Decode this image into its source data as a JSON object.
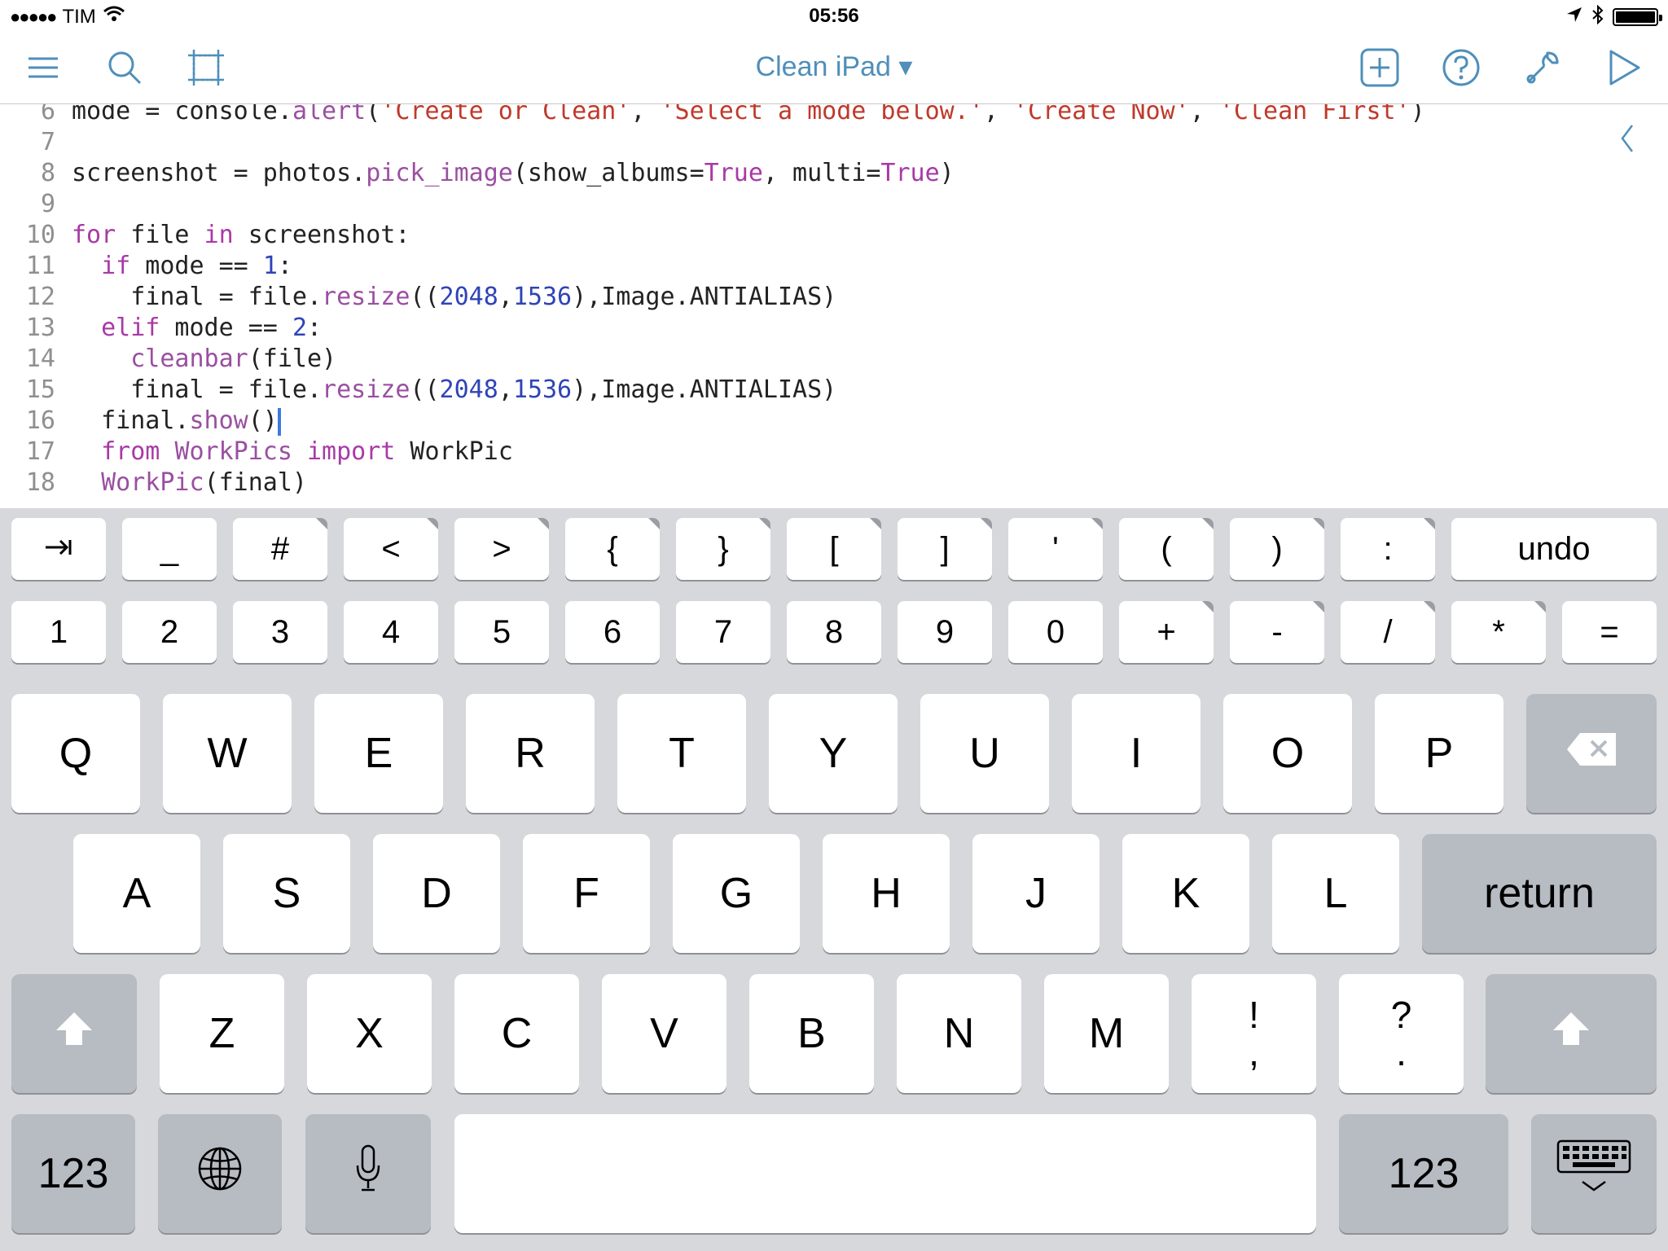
{
  "status_bar": {
    "signal": "●●●●●",
    "carrier": "TIM",
    "time": "05:56",
    "battery_level": 1.0
  },
  "toolbar": {
    "title": "Clean iPad ▾",
    "icons": [
      "menu-icon",
      "search-icon",
      "grid-icon",
      "add-icon",
      "help-icon",
      "wrench-icon",
      "play-icon"
    ],
    "accent_color": "#4f8fba"
  },
  "editor": {
    "lines": [
      {
        "n": "6",
        "code": [
          {
            "t": "mode = console.",
            "c": "plain"
          },
          {
            "t": "alert",
            "c": "fn"
          },
          {
            "t": "(",
            "c": "plain"
          },
          {
            "t": "'Create or Clean'",
            "c": "str"
          },
          {
            "t": ", ",
            "c": "plain"
          },
          {
            "t": "'Select a mode below.'",
            "c": "str"
          },
          {
            "t": ", ",
            "c": "plain"
          },
          {
            "t": "'Create Now'",
            "c": "str"
          },
          {
            "t": ", ",
            "c": "plain"
          },
          {
            "t": "'Clean First'",
            "c": "str"
          },
          {
            "t": ")",
            "c": "plain"
          }
        ]
      },
      {
        "n": "7",
        "code": []
      },
      {
        "n": "8",
        "code": [
          {
            "t": "screenshot = photos.",
            "c": "plain"
          },
          {
            "t": "pick_image",
            "c": "fn"
          },
          {
            "t": "(show_albums=",
            "c": "plain"
          },
          {
            "t": "True",
            "c": "kw"
          },
          {
            "t": ", multi=",
            "c": "plain"
          },
          {
            "t": "True",
            "c": "kw"
          },
          {
            "t": ")",
            "c": "plain"
          }
        ]
      },
      {
        "n": "9",
        "code": []
      },
      {
        "n": "10",
        "code": [
          {
            "t": "for",
            "c": "kw"
          },
          {
            "t": " file ",
            "c": "plain"
          },
          {
            "t": "in",
            "c": "kw"
          },
          {
            "t": " screenshot:",
            "c": "plain"
          }
        ]
      },
      {
        "n": "11",
        "code": [
          {
            "t": "  ",
            "c": "plain"
          },
          {
            "t": "if",
            "c": "kw"
          },
          {
            "t": " mode == ",
            "c": "plain"
          },
          {
            "t": "1",
            "c": "num"
          },
          {
            "t": ":",
            "c": "plain"
          }
        ]
      },
      {
        "n": "12",
        "code": [
          {
            "t": "    final = file.",
            "c": "plain"
          },
          {
            "t": "resize",
            "c": "fn"
          },
          {
            "t": "((",
            "c": "plain"
          },
          {
            "t": "2048",
            "c": "num"
          },
          {
            "t": ",",
            "c": "plain"
          },
          {
            "t": "1536",
            "c": "num"
          },
          {
            "t": "),Image.ANTIALIAS)",
            "c": "plain"
          }
        ]
      },
      {
        "n": "13",
        "code": [
          {
            "t": "  ",
            "c": "plain"
          },
          {
            "t": "elif",
            "c": "kw"
          },
          {
            "t": " mode == ",
            "c": "plain"
          },
          {
            "t": "2",
            "c": "num"
          },
          {
            "t": ":",
            "c": "plain"
          }
        ]
      },
      {
        "n": "14",
        "code": [
          {
            "t": "    ",
            "c": "plain"
          },
          {
            "t": "cleanbar",
            "c": "fn"
          },
          {
            "t": "(file)",
            "c": "plain"
          }
        ]
      },
      {
        "n": "15",
        "code": [
          {
            "t": "    final = file.",
            "c": "plain"
          },
          {
            "t": "resize",
            "c": "fn"
          },
          {
            "t": "((",
            "c": "plain"
          },
          {
            "t": "2048",
            "c": "num"
          },
          {
            "t": ",",
            "c": "plain"
          },
          {
            "t": "1536",
            "c": "num"
          },
          {
            "t": "),Image.ANTIALIAS)",
            "c": "plain"
          }
        ]
      },
      {
        "n": "16",
        "code": [
          {
            "t": "  final.",
            "c": "plain"
          },
          {
            "t": "show",
            "c": "fn"
          },
          {
            "t": "()",
            "c": "plain"
          }
        ],
        "cursor": true
      },
      {
        "n": "17",
        "code": [
          {
            "t": "  ",
            "c": "plain"
          },
          {
            "t": "from",
            "c": "kw"
          },
          {
            "t": " ",
            "c": "plain"
          },
          {
            "t": "WorkPics",
            "c": "fn"
          },
          {
            "t": " ",
            "c": "plain"
          },
          {
            "t": "import",
            "c": "kw"
          },
          {
            "t": " WorkPic",
            "c": "plain"
          }
        ]
      },
      {
        "n": "18",
        "code": [
          {
            "t": "  ",
            "c": "plain"
          },
          {
            "t": "WorkPic",
            "c": "fn"
          },
          {
            "t": "(final)",
            "c": "plain"
          }
        ]
      }
    ]
  },
  "keyboard": {
    "extra_row1": [
      "⇥",
      "_",
      "#",
      "<",
      ">",
      "{",
      "}",
      "[",
      "]",
      "'",
      "(",
      ")",
      ":"
    ],
    "undo_label": "undo",
    "extra_row2": [
      "1",
      "2",
      "3",
      "4",
      "5",
      "6",
      "7",
      "8",
      "9",
      "0",
      "+",
      "-",
      "/",
      "*",
      "="
    ],
    "row_q": [
      "Q",
      "W",
      "E",
      "R",
      "T",
      "Y",
      "U",
      "I",
      "O",
      "P"
    ],
    "row_a": [
      "A",
      "S",
      "D",
      "F",
      "G",
      "H",
      "J",
      "K",
      "L"
    ],
    "return_label": "return",
    "row_z": [
      "Z",
      "X",
      "C",
      "V",
      "B",
      "N",
      "M"
    ],
    "punct_keys": [
      {
        "top": "!",
        "bottom": ","
      },
      {
        "top": "?",
        "bottom": "."
      }
    ],
    "numbers_label": "123",
    "icons": [
      "tab-icon",
      "backspace-icon",
      "shift-icon",
      "globe-icon",
      "microphone-icon",
      "hide-keyboard-icon"
    ]
  }
}
